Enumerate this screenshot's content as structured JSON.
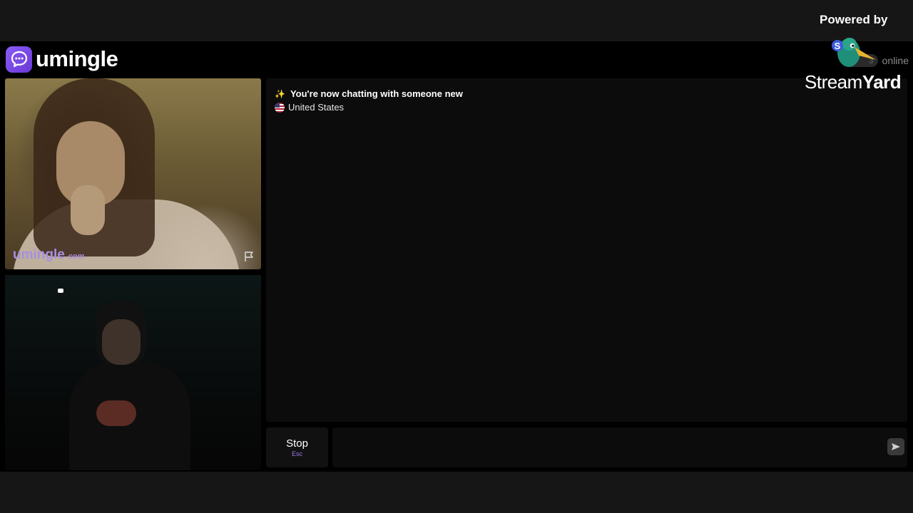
{
  "app": {
    "brand": "umingle",
    "online_count": "3",
    "online_label": "online"
  },
  "remote_video": {
    "watermark": "umingle",
    "watermark_domain": ".com"
  },
  "chat": {
    "status_message": "You're now chatting with someone new",
    "partner_country": "United States"
  },
  "controls": {
    "stop_label": "Stop",
    "stop_shortcut": "Esc",
    "message_value": ""
  },
  "overlay": {
    "powered_by": "Powered by",
    "stream_word": "Stream",
    "yard_word": "Yard"
  },
  "colors": {
    "accent": "#7c4ee8",
    "background": "#000000",
    "frame": "#161616"
  },
  "icons": [
    "chat-bubble-icon",
    "flag-icon",
    "sparkle-icon",
    "us-flag-icon",
    "send-icon",
    "streamyard-logo-icon"
  ]
}
